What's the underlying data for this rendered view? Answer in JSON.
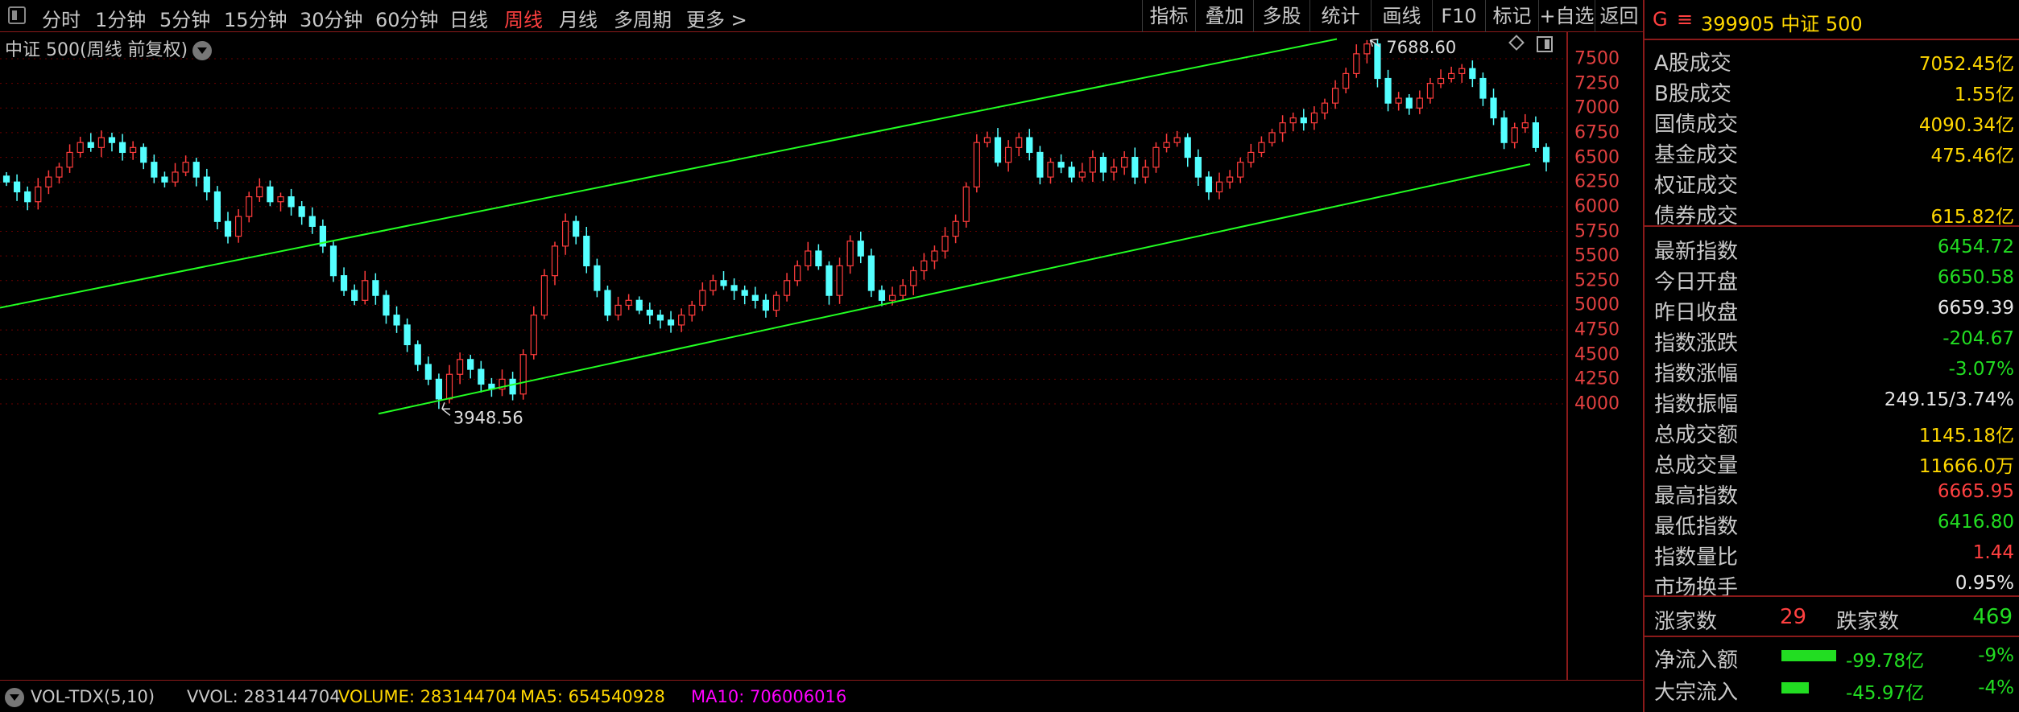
{
  "toolbar": {
    "periods": [
      {
        "label": "分时",
        "active": false
      },
      {
        "label": "1分钟",
        "active": false
      },
      {
        "label": "5分钟",
        "active": false
      },
      {
        "label": "15分钟",
        "active": false
      },
      {
        "label": "30分钟",
        "active": false
      },
      {
        "label": "60分钟",
        "active": false
      },
      {
        "label": "日线",
        "active": false
      },
      {
        "label": "周线",
        "active": true
      },
      {
        "label": "月线",
        "active": false
      },
      {
        "label": "多周期",
        "active": false
      },
      {
        "label": "更多 >",
        "active": false
      }
    ],
    "tools": [
      "指标",
      "叠加",
      "多股",
      "统计",
      "画线",
      "F10",
      "标记",
      "+自选",
      "返回"
    ]
  },
  "chart": {
    "title": "中证 500(周线 前复权)",
    "y_ticks": [
      "7500",
      "7250",
      "7000",
      "6750",
      "6500",
      "6250",
      "6000",
      "5750",
      "5500",
      "5250",
      "5000",
      "4750",
      "4500",
      "4250",
      "4000"
    ],
    "high_label": "7688.60",
    "low_label": "3948.56",
    "colors": {
      "up": "#ff3c3c",
      "down": "#54ffff",
      "channel": "#22ff22",
      "grid": "#6b0000"
    }
  },
  "chart_data": {
    "type": "candlestick",
    "title": "中证 500(周线 前复权)",
    "ylim": [
      3800,
      7750
    ],
    "annotations": [
      {
        "label": "7688.60",
        "value": 7688.6
      },
      {
        "label": "3948.56",
        "value": 3948.56
      }
    ],
    "closes": [
      6250,
      6150,
      6050,
      6200,
      6300,
      6400,
      6550,
      6650,
      6600,
      6700,
      6650,
      6550,
      6600,
      6450,
      6300,
      6250,
      6350,
      6450,
      6300,
      6150,
      5850,
      5700,
      5900,
      6100,
      6200,
      6050,
      6100,
      6000,
      5900,
      5800,
      5600,
      5300,
      5150,
      5050,
      5250,
      5100,
      4900,
      4800,
      4600,
      4400,
      4250,
      4050,
      4300,
      4450,
      4350,
      4200,
      4150,
      4250,
      4100,
      4500,
      4900,
      5300,
      5600,
      5850,
      5700,
      5400,
      5150,
      4900,
      5000,
      5050,
      4950,
      4900,
      4850,
      4800,
      4900,
      5000,
      5150,
      5250,
      5200,
      5150,
      5100,
      5050,
      4950,
      5100,
      5250,
      5400,
      5550,
      5400,
      5100,
      5400,
      5650,
      5500,
      5150,
      5050,
      5100,
      5200,
      5350,
      5450,
      5550,
      5700,
      5850,
      6200,
      6650,
      6700,
      6450,
      6600,
      6700,
      6550,
      6300,
      6450,
      6400,
      6300,
      6350,
      6500,
      6350,
      6400,
      6500,
      6300,
      6400,
      6600,
      6650,
      6700,
      6500,
      6300,
      6150,
      6250,
      6300,
      6450,
      6550,
      6650,
      6750,
      6850,
      6900,
      6850,
      6950,
      7050,
      7200,
      7350,
      7550,
      7650,
      7300,
      7050,
      7100,
      7000,
      7100,
      7250,
      7300,
      7350,
      7400,
      7300,
      7100,
      6900,
      6650,
      6800,
      6850,
      6600,
      6455
    ]
  },
  "bottom_bar": {
    "indicator": "VOL-TDX(5,10)",
    "vvol": "VVOL: 283144704",
    "volume": "VOLUME: 283144704",
    "ma5": "MA5: 654540928",
    "ma10": "MA10: 706006016"
  },
  "panel": {
    "g": "G",
    "menu": "≡",
    "code": "399905 中证 500",
    "rows": [
      {
        "label": "A股成交",
        "value": "7052.45亿",
        "color": "#ffd700"
      },
      {
        "label": "B股成交",
        "value": "1.55亿",
        "color": "#ffd700"
      },
      {
        "label": "国债成交",
        "value": "4090.34亿",
        "color": "#ffd700"
      },
      {
        "label": "基金成交",
        "value": "475.46亿",
        "color": "#ffd700"
      },
      {
        "label": "权证成交",
        "value": "",
        "color": "#ffd700"
      },
      {
        "label": "债券成交",
        "value": "615.82亿",
        "color": "#ffd700"
      },
      {
        "label": "最新指数",
        "value": "6454.72",
        "color": "#22dd22"
      },
      {
        "label": "今日开盘",
        "value": "6650.58",
        "color": "#22dd22"
      },
      {
        "label": "昨日收盘",
        "value": "6659.39",
        "color": "#e6e6e6"
      },
      {
        "label": "指数涨跌",
        "value": "-204.67",
        "color": "#22dd22"
      },
      {
        "label": "指数涨幅",
        "value": "-3.07%",
        "color": "#22dd22"
      },
      {
        "label": "指数振幅",
        "value": "249.15/3.74%",
        "color": "#e6e6e6"
      },
      {
        "label": "总成交额",
        "value": "1145.18亿",
        "color": "#ffd700"
      },
      {
        "label": "总成交量",
        "value": "11666.0万",
        "color": "#ffd700"
      },
      {
        "label": "最高指数",
        "value": "6665.95",
        "color": "#ff4040"
      },
      {
        "label": "最低指数",
        "value": "6416.80",
        "color": "#22dd22"
      },
      {
        "label": "指数量比",
        "value": "1.44",
        "color": "#ff4040"
      },
      {
        "label": "市场换手",
        "value": "0.95%",
        "color": "#e6e6e6"
      }
    ],
    "advancers_label": "涨家数",
    "advancers": "29",
    "decliners_label": "跌家数",
    "decliners": "469",
    "flows": [
      {
        "label": "净流入额",
        "amount": "-99.78亿",
        "pct": "-9%",
        "bar": 0.9
      },
      {
        "label": "大宗流入",
        "amount": "-45.97亿",
        "pct": "-4%",
        "bar": 0.45
      }
    ]
  }
}
